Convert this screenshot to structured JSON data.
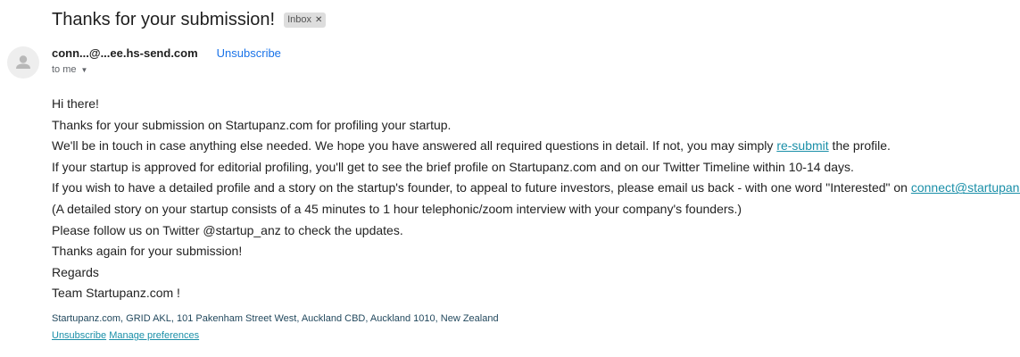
{
  "email": {
    "subject": "Thanks for your submission!",
    "label": "Inbox",
    "sender": "conn...@...ee.hs-send.com",
    "unsubscribe_label": "Unsubscribe",
    "to_label": "to me"
  },
  "body": {
    "greeting": "Hi there!",
    "line1": "Thanks for your submission on Startupanz.com for profiling your startup.",
    "line2_before": "We'll be in touch in case anything else needed. We hope you have answered all required questions in detail. If not, you may simply ",
    "line2_link": "re-submit",
    "line2_after": " the profile.",
    "line3": "If your startup is approved for editorial profiling, you'll get to see the brief profile on Startupanz.com and on our Twitter Timeline within 10-14 days.",
    "line4_before": "If you wish to have a detailed profile and a story on the startup's founder, to appeal to future investors, please email us back - with one word \"Interested\" on ",
    "line4_link": "connect@startupanz.com",
    "line5": "(A detailed story on your startup consists of a 45 minutes to 1 hour telephonic/zoom interview with your company's founders.)",
    "line6": "Please follow us on Twitter @startup_anz to check the updates.",
    "line7": "Thanks again for your submission!",
    "line8": "Regards",
    "line9": "Team Startupanz.com !"
  },
  "footer": {
    "address": "Startupanz.com, GRID AKL, 101 Pakenham Street West, Auckland CBD, Auckland 1010, New Zealand",
    "unsubscribe": "Unsubscribe",
    "manage": "Manage preferences"
  },
  "icons": {
    "avatar": "person-icon",
    "label_close": "close-icon",
    "recipient_caret": "chevron-down-icon"
  },
  "colors": {
    "link": "#1a8fa8",
    "unsubscribe_top": "#1a73e8",
    "footer_text": "#23495e",
    "chip_bg": "#dddddd"
  }
}
